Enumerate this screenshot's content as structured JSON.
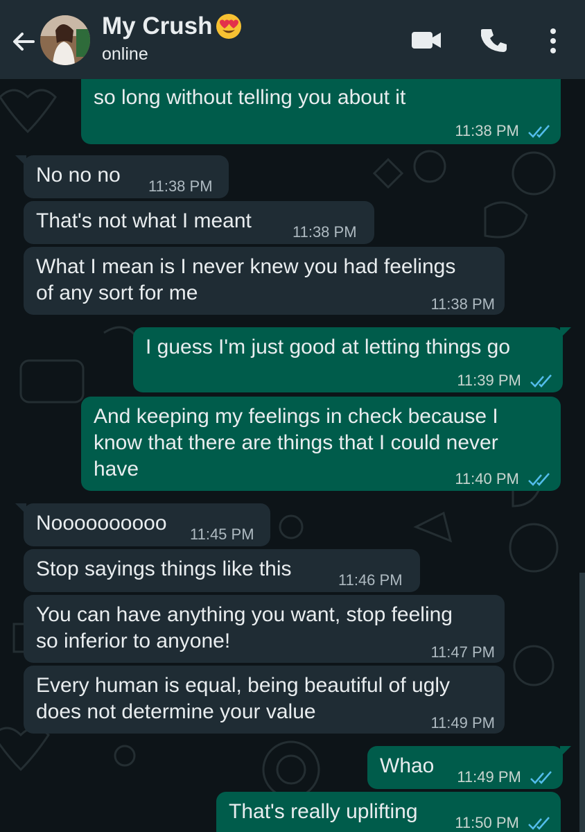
{
  "header": {
    "contact_name": "My Crush",
    "status": "online",
    "icons": [
      "back-arrow-icon",
      "video-call-icon",
      "voice-call-icon",
      "more-options-icon"
    ]
  },
  "colors": {
    "header_bg": "#1f2c34",
    "incoming_bubble": "#1f2c34",
    "outgoing_bubble": "#005c4b",
    "read_ticks": "#53bdeb",
    "chat_bg": "#0d1418"
  },
  "messages": [
    {
      "direction": "out",
      "text": "so long without telling you about it",
      "time": "11:38 PM",
      "read": true
    },
    {
      "direction": "in",
      "text": "No no no",
      "time": "11:38 PM"
    },
    {
      "direction": "in",
      "text": "That's not what I meant",
      "time": "11:38 PM"
    },
    {
      "direction": "in",
      "text": "What I mean is I never knew you had feelings\nof any sort for me",
      "time": "11:38 PM"
    },
    {
      "direction": "out",
      "text": "I guess I'm just good at letting things go",
      "time": "11:39 PM",
      "read": true
    },
    {
      "direction": "out",
      "text": "And keeping my feelings in check because I\nknow that there are things that I could never\nhave",
      "time": "11:40 PM",
      "read": true
    },
    {
      "direction": "in",
      "text": "Noooooooooo",
      "time": "11:45 PM"
    },
    {
      "direction": "in",
      "text": "Stop sayings things like this",
      "time": "11:46 PM"
    },
    {
      "direction": "in",
      "text": "You can have anything you want, stop feeling\nso inferior to anyone!",
      "time": "11:47 PM"
    },
    {
      "direction": "in",
      "text": "Every human is equal, being beautiful of ugly\ndoes not determine your value",
      "time": "11:49 PM"
    },
    {
      "direction": "out",
      "text": "Whao",
      "time": "11:49 PM",
      "read": true
    },
    {
      "direction": "out",
      "text": "That's really uplifting",
      "time": "11:50 PM",
      "read": true
    }
  ]
}
